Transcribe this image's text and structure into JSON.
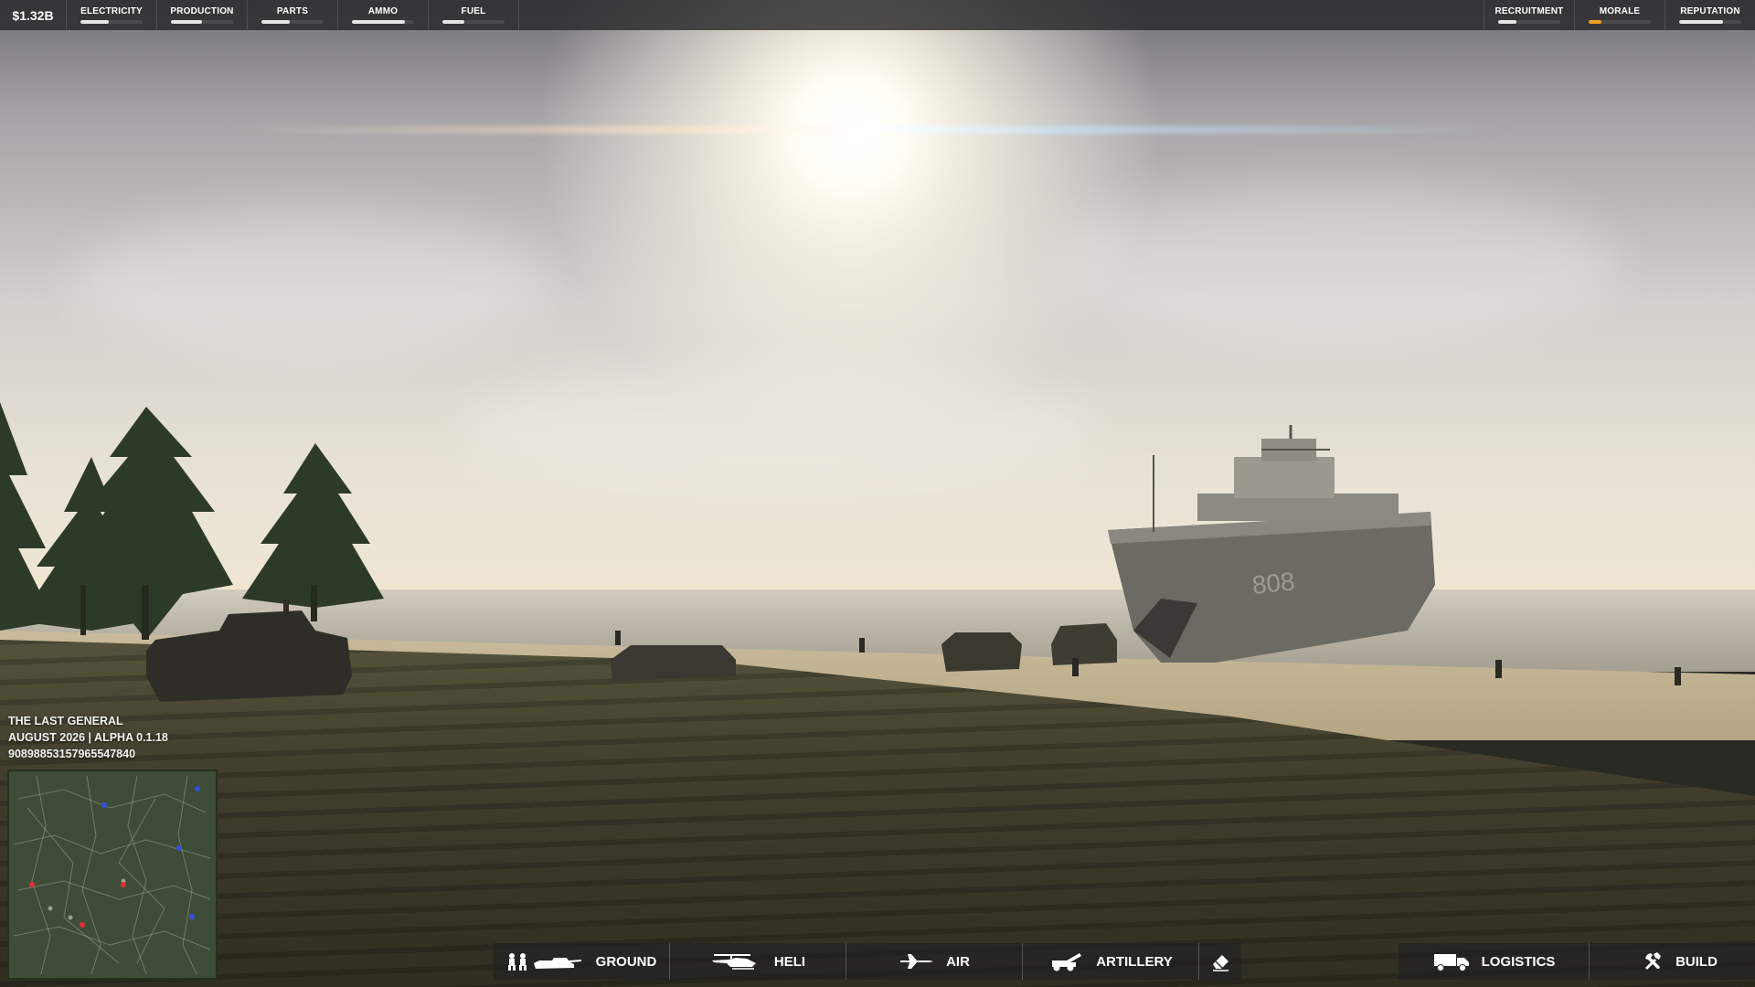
{
  "top_bar": {
    "money": "$1.32B",
    "resources_left": [
      {
        "label": "ELECTRICITY",
        "level": 0.45,
        "name": "electricity"
      },
      {
        "label": "PRODUCTION",
        "level": 0.5,
        "name": "production"
      },
      {
        "label": "PARTS",
        "level": 0.45,
        "name": "parts"
      },
      {
        "label": "AMMO",
        "level": 0.85,
        "name": "ammo"
      },
      {
        "label": "FUEL",
        "level": 0.35,
        "name": "fuel"
      }
    ],
    "resources_right": [
      {
        "label": "RECRUITMENT",
        "level": 0.3,
        "name": "recruitment"
      },
      {
        "label": "MORALE",
        "level": 0.2,
        "name": "morale",
        "color": "#f0a020"
      },
      {
        "label": "REPUTATION",
        "level": 0.7,
        "name": "reputation"
      }
    ]
  },
  "info": {
    "game_title": "THE LAST GENERAL",
    "date_version": "AUGUST 2026 | ALPHA 0.1.18",
    "seed": "90898853157965547840"
  },
  "bottom_bar": {
    "ground": {
      "label": "GROUND",
      "icon": "soldiers-tank-icon"
    },
    "heli": {
      "label": "HELI",
      "icon": "helicopter-icon"
    },
    "air": {
      "label": "AIR",
      "icon": "jet-icon"
    },
    "artillery": {
      "label": "ARTILLERY",
      "icon": "artillery-icon"
    },
    "erase": {
      "icon": "eraser-icon"
    },
    "logistics": {
      "label": "LOGISTICS",
      "icon": "truck-icon"
    },
    "build": {
      "label": "BUILD",
      "icon": "tools-icon"
    }
  },
  "scene": {
    "ship_hull_number": "808"
  },
  "colors": {
    "bar_fill": "#e6e6e6",
    "morale_fill": "#f0a020",
    "minimap_blue": "#3050e0",
    "minimap_red": "#e03030"
  }
}
